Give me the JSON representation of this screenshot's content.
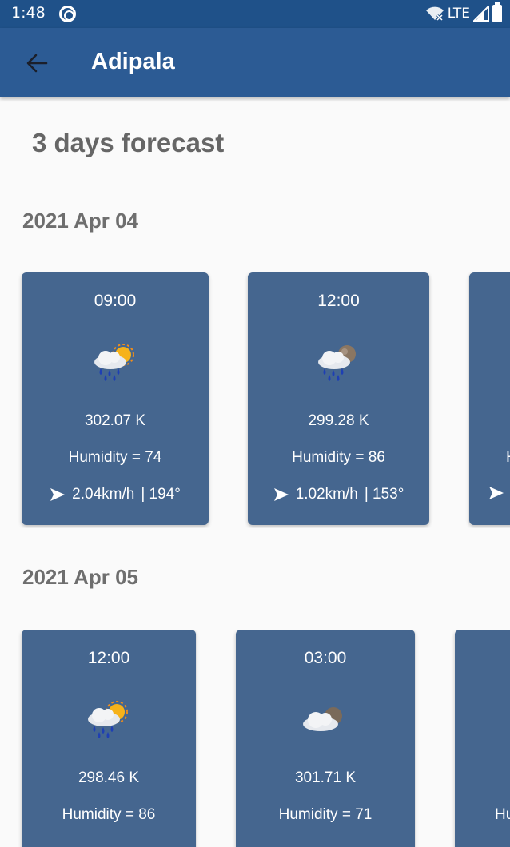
{
  "status_bar": {
    "time": "1:48",
    "network": "LTE"
  },
  "app_bar": {
    "title": "Adipala"
  },
  "forecast_title": "3 days forecast",
  "days": [
    {
      "date": "2021 Apr 04",
      "cards": [
        {
          "time": "09:00",
          "icon": "rain-sun-icon",
          "temp": "302.07 K",
          "humidity": "Humidity = 74",
          "speed": "2.04km/h",
          "direction": "| 194°"
        },
        {
          "time": "12:00",
          "icon": "rain-moon-icon",
          "temp": "299.28 K",
          "humidity": "Humidity = 86",
          "speed": "1.02km/h",
          "direction": "| 153°"
        },
        {
          "time": "",
          "icon": "",
          "temp": "",
          "humidity": "H",
          "speed": "",
          "direction": ""
        }
      ]
    },
    {
      "date": "2021 Apr 05",
      "cards": [
        {
          "time": "12:00",
          "icon": "rain-sun-icon",
          "temp": "298.46 K",
          "humidity": "Humidity = 86"
        },
        {
          "time": "03:00",
          "icon": "cloud-moon-icon",
          "temp": "301.71 K",
          "humidity": "Humidity = 71"
        },
        {
          "time": "",
          "icon": "",
          "temp": "",
          "humidity": "Hu"
        }
      ]
    }
  ],
  "colors": {
    "status_bar": "#1f5189",
    "app_bar": "#2c5b94",
    "card": "#45668f"
  }
}
